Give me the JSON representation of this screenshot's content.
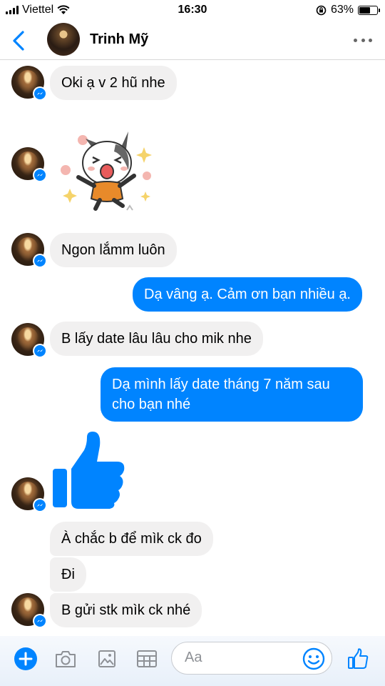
{
  "status_bar": {
    "carrier": "Viettel",
    "time": "16:30",
    "battery_percent": "63%",
    "battery_level": 0.63
  },
  "header": {
    "contact_name": "Trinh Mỹ"
  },
  "messages": [
    {
      "text": "Oki ạ v 2 hũ nhe"
    },
    {
      "text": "Ngon lắmm luôn"
    },
    {
      "text": "Dạ vâng ạ. Cảm ơn bạn nhiều ạ."
    },
    {
      "text": "B lấy date lâu lâu cho mik nhe"
    },
    {
      "text": "Dạ mình lấy date tháng 7 năm sau cho bạn nhé"
    },
    {
      "text": "À chắc b để mìk ck đo"
    },
    {
      "text": "Đi"
    },
    {
      "text": "B gửi stk mìk ck nhé"
    }
  ],
  "composer": {
    "placeholder": "Aa"
  },
  "colors": {
    "accent": "#0084ff",
    "incoming_bubble": "#f1f0f0"
  }
}
